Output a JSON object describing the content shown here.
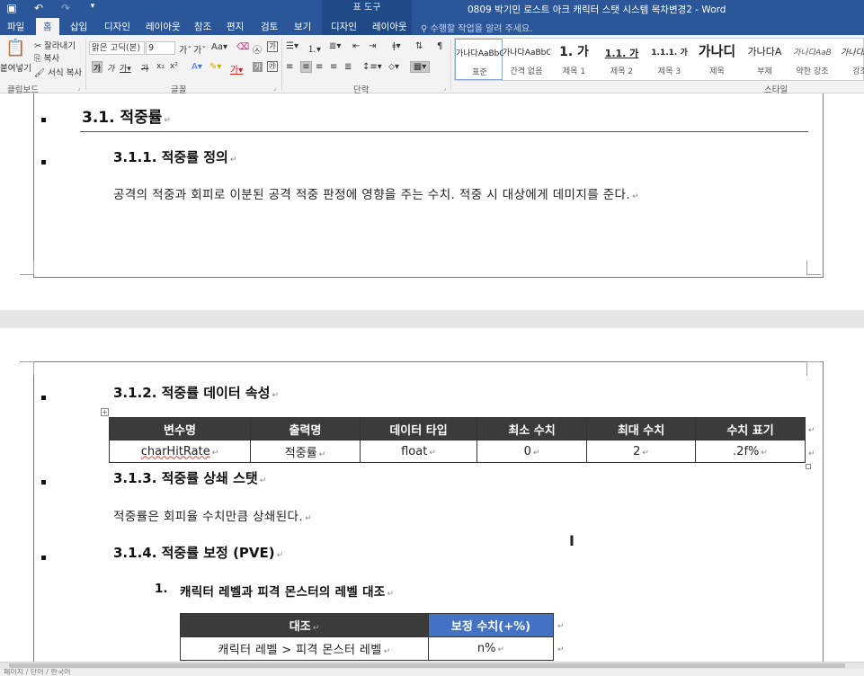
{
  "titlebar": {
    "contextual_header": "표 도구",
    "window_title": "0809 박기민 로스트 아크 캐릭터 스탯 시스템 목차변경2 - Word"
  },
  "tabs": [
    {
      "label": "파일"
    },
    {
      "label": "홈"
    },
    {
      "label": "삽입"
    },
    {
      "label": "디자인"
    },
    {
      "label": "레이아웃"
    },
    {
      "label": "참조"
    },
    {
      "label": "편지"
    },
    {
      "label": "검토"
    },
    {
      "label": "보기"
    },
    {
      "label": "디자인"
    },
    {
      "label": "레이아웃"
    }
  ],
  "tell_me": "수행할 작업을 알려 주세요.",
  "ribbon": {
    "clipboard": {
      "paste": "붙여넣기",
      "cut": "잘라내기",
      "copy": "복사",
      "format_painter": "서식 복사",
      "label": "클립보드"
    },
    "font": {
      "font_name": "맑은 고딕(본)",
      "font_size": "9",
      "label": "글꼴"
    },
    "paragraph": {
      "label": "단락"
    },
    "styles": {
      "label": "스타일",
      "items": [
        {
          "sample": "가나다AaBbC",
          "name": "표준"
        },
        {
          "sample": "가나다AaBbC",
          "name": "간격 없음"
        },
        {
          "sample": "1.  가",
          "name": "제목 1"
        },
        {
          "sample": "1.1.  가",
          "name": "제목 2"
        },
        {
          "sample": "1.1.1.  가",
          "name": "제목 3"
        },
        {
          "sample": "가나디",
          "name": "제목"
        },
        {
          "sample": "가나다A",
          "name": "부제"
        },
        {
          "sample": "가나다AaB",
          "name": "약한 강조"
        },
        {
          "sample": "가나다AaB",
          "name": "강조"
        }
      ]
    }
  },
  "document": {
    "sec_3_1": "3.1. 적중률",
    "sec_3_1_1": "3.1.1. 적중률 정의",
    "def_text": "공격의 적중과 회피로 이분된 공격 적중 판정에 영향을 주는 수치. 적중 시 대상에게 데미지를 준다.",
    "sec_3_1_2": "3.1.2. 적중률 데이터 속성",
    "attr_table": {
      "headers": [
        "변수명",
        "출력명",
        "데이터 타입",
        "최소 수치",
        "최대 수치",
        "수치 표기"
      ],
      "row": [
        "charHitRate",
        "적중률",
        "float",
        "0",
        "2",
        ".2f%"
      ]
    },
    "sec_3_1_3": "3.1.3. 적중률 상쇄 스탯",
    "offset_text": "적중률은 회피율 수치만큼 상쇄된다.",
    "sec_3_1_4": "3.1.4. 적중률 보정 (PVE)",
    "item_1_num": "1.",
    "item_1": "캐릭터 레벨과 피격 몬스터의 레벨 대조",
    "cmp_table": {
      "headers": [
        "대조",
        "보정 수치(+%)"
      ],
      "row": [
        "캐릭터 레벨 > 피격 몬스터 레벨",
        "n%"
      ]
    }
  },
  "statusbar": {
    "text": "페이지 / 단어 / 한국어"
  }
}
